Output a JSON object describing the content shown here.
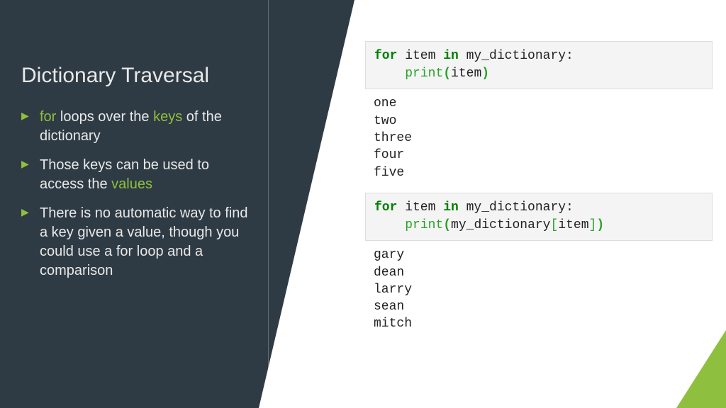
{
  "title": "Dictionary Traversal",
  "bullets": [
    {
      "pre": "",
      "hl1": "for",
      "mid": " loops over the ",
      "hl2": "keys",
      "post": " of the dictionary"
    },
    {
      "pre": "Those keys can be used to access the ",
      "hl1": "values",
      "mid": "",
      "hl2": "",
      "post": ""
    },
    {
      "pre": "There is no automatic way to find a key given a value, though you could use a for loop and a comparison",
      "hl1": "",
      "mid": "",
      "hl2": "",
      "post": ""
    }
  ],
  "code1": {
    "kw_for": "for",
    "item": " item ",
    "kw_in": "in",
    "rest": " my_dictionary:",
    "indent": "    ",
    "fn": "print",
    "open": "(",
    "arg": "item",
    "close": ")"
  },
  "output1": "one\ntwo\nthree\nfour\nfive",
  "code2": {
    "kw_for": "for",
    "item": " item ",
    "kw_in": "in",
    "rest": " my_dictionary:",
    "indent": "    ",
    "fn": "print",
    "open": "(",
    "arg1": "my_dictionary",
    "lb": "[",
    "arg2": "item",
    "rb": "]",
    "close": ")"
  },
  "output2": "gary\ndean\nlarry\nsean\nmitch"
}
